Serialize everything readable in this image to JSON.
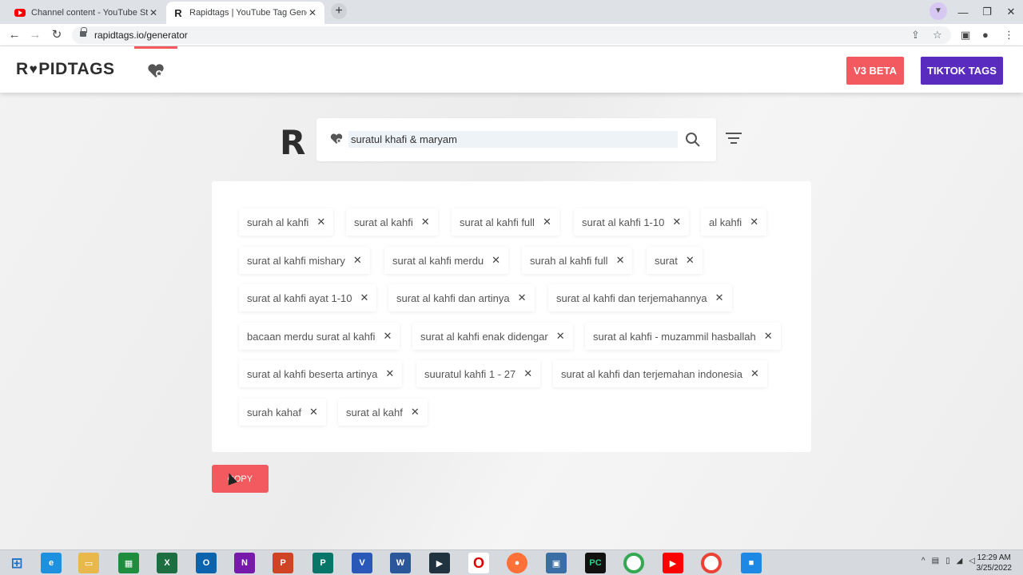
{
  "browser": {
    "tabs": [
      {
        "title": "Channel content - YouTube Studio",
        "favicon": "youtube-icon"
      },
      {
        "title": "Rapidtags | YouTube Tag Generator",
        "favicon": "rapidtags-icon",
        "active": true
      }
    ],
    "url": "rapidtags.io/generator"
  },
  "header": {
    "logo_pre": "R",
    "logo_post": "PIDTAGS",
    "v3_label": "V3 BETA",
    "tiktok_label": "TIKTOK TAGS"
  },
  "search": {
    "big_logo": "R",
    "value": "suratul khafi & maryam"
  },
  "tags": [
    "surah al kahfi",
    "surat al kahfi",
    "surat al kahfi full",
    "surat al kahfi 1-10",
    "al kahfi",
    "surat al kahfi mishary",
    "surat al kahfi merdu",
    "surah al kahfi full",
    "surat",
    "surat al kahfi ayat 1-10",
    "surat al kahfi dan artinya",
    "surat al kahfi dan terjemahannya",
    "bacaan merdu surat al kahfi",
    "surat al kahfi enak didengar",
    "surat al kahfi - muzammil hasballah",
    "surat al kahfi beserta artinya",
    "suuratul kahfi 1 - 27",
    "surat al kahfi dan terjemahan indonesia",
    "surah kahaf",
    "surat al kahf"
  ],
  "copy_label": "COPY",
  "taskbar": {
    "time": "12:29 AM",
    "date": "3/25/2022"
  },
  "colors": {
    "accent_red": "#f25a5f",
    "accent_purple": "#5a2bbf"
  }
}
